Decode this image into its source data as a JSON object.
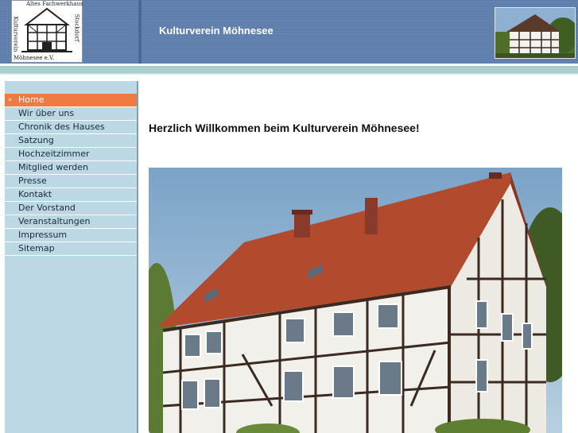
{
  "header": {
    "logo_top_text": "Altes Fachwerkhaus",
    "logo_right_text": "Stockdorf",
    "logo_left_text": "Kulturverein",
    "logo_bottom_text": "Möhnesee e.V.",
    "site_title": "Kulturverein Möhnesee"
  },
  "sidebar": {
    "items": [
      {
        "label": "Home",
        "active": true
      },
      {
        "label": "Wir über uns"
      },
      {
        "label": "Chronik des Hauses"
      },
      {
        "label": "Satzung"
      },
      {
        "label": "Hochzeitzimmer"
      },
      {
        "label": "Mitglied werden"
      },
      {
        "label": "Presse"
      },
      {
        "label": "Kontakt"
      },
      {
        "label": "Der Vorstand"
      },
      {
        "label": "Veranstaltungen"
      },
      {
        "label": "Impressum"
      },
      {
        "label": "Sitemap"
      }
    ],
    "bullet": "»"
  },
  "main": {
    "welcome": "Herzlich Willkommen beim Kulturverein Möhnesee!"
  },
  "colors": {
    "header": "#5a7aa8",
    "nav_active": "#f07b42",
    "sidebar": "#bcd8e4"
  }
}
